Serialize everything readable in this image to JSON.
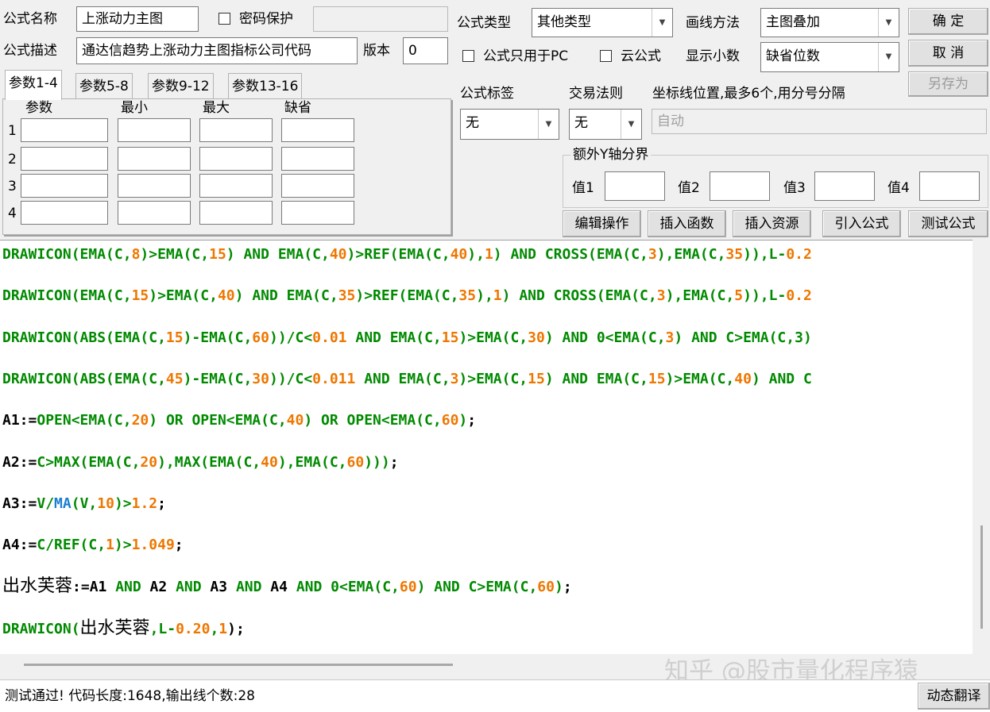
{
  "top": {
    "formula_name_label": "公式名称",
    "formula_name_value": "上涨动力主图",
    "password_label": "密码保护",
    "password_value": "",
    "formula_desc_label": "公式描述",
    "formula_desc_value": "通达信趋势上涨动力主图指标公司代码",
    "version_label": "版本",
    "version_value": "0",
    "formula_type_label": "公式类型",
    "formula_type_value": "其他类型",
    "draw_method_label": "画线方法",
    "draw_method_value": "主图叠加",
    "pc_only_label": "公式只用于PC",
    "cloud_label": "云公式",
    "decimals_label": "显示小数",
    "decimals_value": "缺省位数",
    "ok_button": "确  定",
    "cancel_button": "取  消",
    "save_as_button": "另存为"
  },
  "params": {
    "tabs": [
      "参数1-4",
      "参数5-8",
      "参数9-12",
      "参数13-16"
    ],
    "headers": [
      "参数",
      "最小",
      "最大",
      "缺省"
    ],
    "rows": [
      "1",
      "2",
      "3",
      "4"
    ]
  },
  "right": {
    "tag_label": "公式标签",
    "tag_value": "无",
    "trade_rule_label": "交易法则",
    "trade_rule_value": "无",
    "coord_label": "坐标线位置,最多6个,用分号分隔",
    "coord_value": "自动",
    "extra_y_label": "额外Y轴分界",
    "val_labels": [
      "值1",
      "值2",
      "值3",
      "值4"
    ]
  },
  "buttons": {
    "edit": "编辑操作",
    "insert_func": "插入函数",
    "insert_res": "插入资源",
    "import": "引入公式",
    "test": "测试公式"
  },
  "code_lines": [
    [
      [
        "k",
        "DRAWICON(EMA(C,"
      ],
      [
        "n",
        "8"
      ],
      [
        "k",
        ")>EMA(C,"
      ],
      [
        "n",
        "15"
      ],
      [
        "k",
        ") AND EMA(C,"
      ],
      [
        "n",
        "40"
      ],
      [
        "k",
        ")>REF(EMA(C,"
      ],
      [
        "n",
        "40"
      ],
      [
        "k",
        "),"
      ],
      [
        "n",
        "1"
      ],
      [
        "k",
        ") AND CROSS(EMA(C,"
      ],
      [
        "n",
        "3"
      ],
      [
        "k",
        "),EMA(C,"
      ],
      [
        "n",
        "35"
      ],
      [
        "k",
        "))"
      ],
      [
        "k",
        ",L-"
      ],
      [
        "n",
        "0.2"
      ]
    ],
    [
      [
        "k",
        "DRAWICON(EMA(C,"
      ],
      [
        "n",
        "15"
      ],
      [
        "k",
        ")>EMA(C,"
      ],
      [
        "n",
        "40"
      ],
      [
        "k",
        ") AND EMA(C,"
      ],
      [
        "n",
        "35"
      ],
      [
        "k",
        ")>REF(EMA(C,"
      ],
      [
        "n",
        "35"
      ],
      [
        "k",
        "),"
      ],
      [
        "n",
        "1"
      ],
      [
        "k",
        ") AND CROSS(EMA(C,"
      ],
      [
        "n",
        "3"
      ],
      [
        "k",
        "),EMA(C,"
      ],
      [
        "n",
        "5"
      ],
      [
        "k",
        "))"
      ],
      [
        "k",
        ",L-"
      ],
      [
        "n",
        "0.2"
      ]
    ],
    [
      [
        "k",
        "DRAWICON(ABS(EMA(C,"
      ],
      [
        "n",
        "15"
      ],
      [
        "k",
        ")-EMA(C,"
      ],
      [
        "n",
        "60"
      ],
      [
        "k",
        "))/C<"
      ],
      [
        "n",
        "0.01"
      ],
      [
        "k",
        " AND EMA(C,"
      ],
      [
        "n",
        "15"
      ],
      [
        "k",
        ")>EMA(C,"
      ],
      [
        "n",
        "30"
      ],
      [
        "k",
        ") AND 0<EMA(C,"
      ],
      [
        "n",
        "3"
      ],
      [
        "k",
        ") AND C>EMA(C,3)"
      ]
    ],
    [
      [
        "k",
        "DRAWICON(ABS(EMA(C,"
      ],
      [
        "n",
        "45"
      ],
      [
        "k",
        ")-EMA(C,"
      ],
      [
        "n",
        "30"
      ],
      [
        "k",
        "))/C<"
      ],
      [
        "n",
        "0.011"
      ],
      [
        "k",
        " AND EMA(C,"
      ],
      [
        "n",
        "3"
      ],
      [
        "k",
        ")>EMA(C,"
      ],
      [
        "n",
        "15"
      ],
      [
        "k",
        ") AND EMA(C,"
      ],
      [
        "n",
        "15"
      ],
      [
        "k",
        ")>EMA(C,"
      ],
      [
        "n",
        "40"
      ],
      [
        "k",
        ") AND C"
      ]
    ],
    [
      [
        "b",
        "A1:="
      ],
      [
        "k",
        "OPEN<EMA(C,"
      ],
      [
        "n",
        "20"
      ],
      [
        "k",
        ") OR OPEN<EMA(C,"
      ],
      [
        "n",
        "40"
      ],
      [
        "k",
        ") OR OPEN<EMA(C,"
      ],
      [
        "n",
        "60"
      ],
      [
        "k",
        ")"
      ],
      [
        "b",
        ";"
      ]
    ],
    [
      [
        "b",
        "A2:="
      ],
      [
        "k",
        "C>MAX(EMA(C,"
      ],
      [
        "n",
        "20"
      ],
      [
        "k",
        "),MAX(EMA(C,"
      ],
      [
        "n",
        "40"
      ],
      [
        "k",
        "),EMA(C,"
      ],
      [
        "n",
        "60"
      ],
      [
        "k",
        ")))"
      ],
      [
        "b",
        ";"
      ]
    ],
    [
      [
        "b",
        "A3:="
      ],
      [
        "k",
        "V/"
      ],
      [
        "u",
        "MA"
      ],
      [
        "k",
        "(V,"
      ],
      [
        "n",
        "10"
      ],
      [
        "k",
        ")>"
      ],
      [
        "n",
        "1.2"
      ],
      [
        "b",
        ";"
      ]
    ],
    [
      [
        "b",
        "A4:="
      ],
      [
        "k",
        "C/REF(C,"
      ],
      [
        "n",
        "1"
      ],
      [
        "k",
        ")>"
      ],
      [
        "n",
        "1.049"
      ],
      [
        "b",
        ";"
      ]
    ],
    [
      [
        "c",
        "出水芙蓉"
      ],
      [
        "b",
        ":=A1 "
      ],
      [
        "k",
        "AND"
      ],
      [
        "b",
        " A2 "
      ],
      [
        "k",
        "AND"
      ],
      [
        "b",
        " A3 "
      ],
      [
        "k",
        "AND"
      ],
      [
        "b",
        " A4 "
      ],
      [
        "k",
        "AND 0<EMA(C,"
      ],
      [
        "n",
        "60"
      ],
      [
        "k",
        ") AND C>EMA(C,"
      ],
      [
        "n",
        "60"
      ],
      [
        "k",
        ")"
      ],
      [
        "b",
        ";"
      ]
    ],
    [
      [
        "k",
        "DRAWICON("
      ],
      [
        "c",
        "出水芙蓉"
      ],
      [
        "k",
        ",L-"
      ],
      [
        "n",
        "0.20"
      ],
      [
        "k",
        ","
      ],
      [
        "n",
        "1"
      ],
      [
        "b",
        ");"
      ]
    ]
  ],
  "watermark": "知乎 @股市量化程序猿",
  "status": {
    "message": "测试通过! 代码长度:1648,输出线个数:28",
    "translate_button": "动态翻译"
  }
}
